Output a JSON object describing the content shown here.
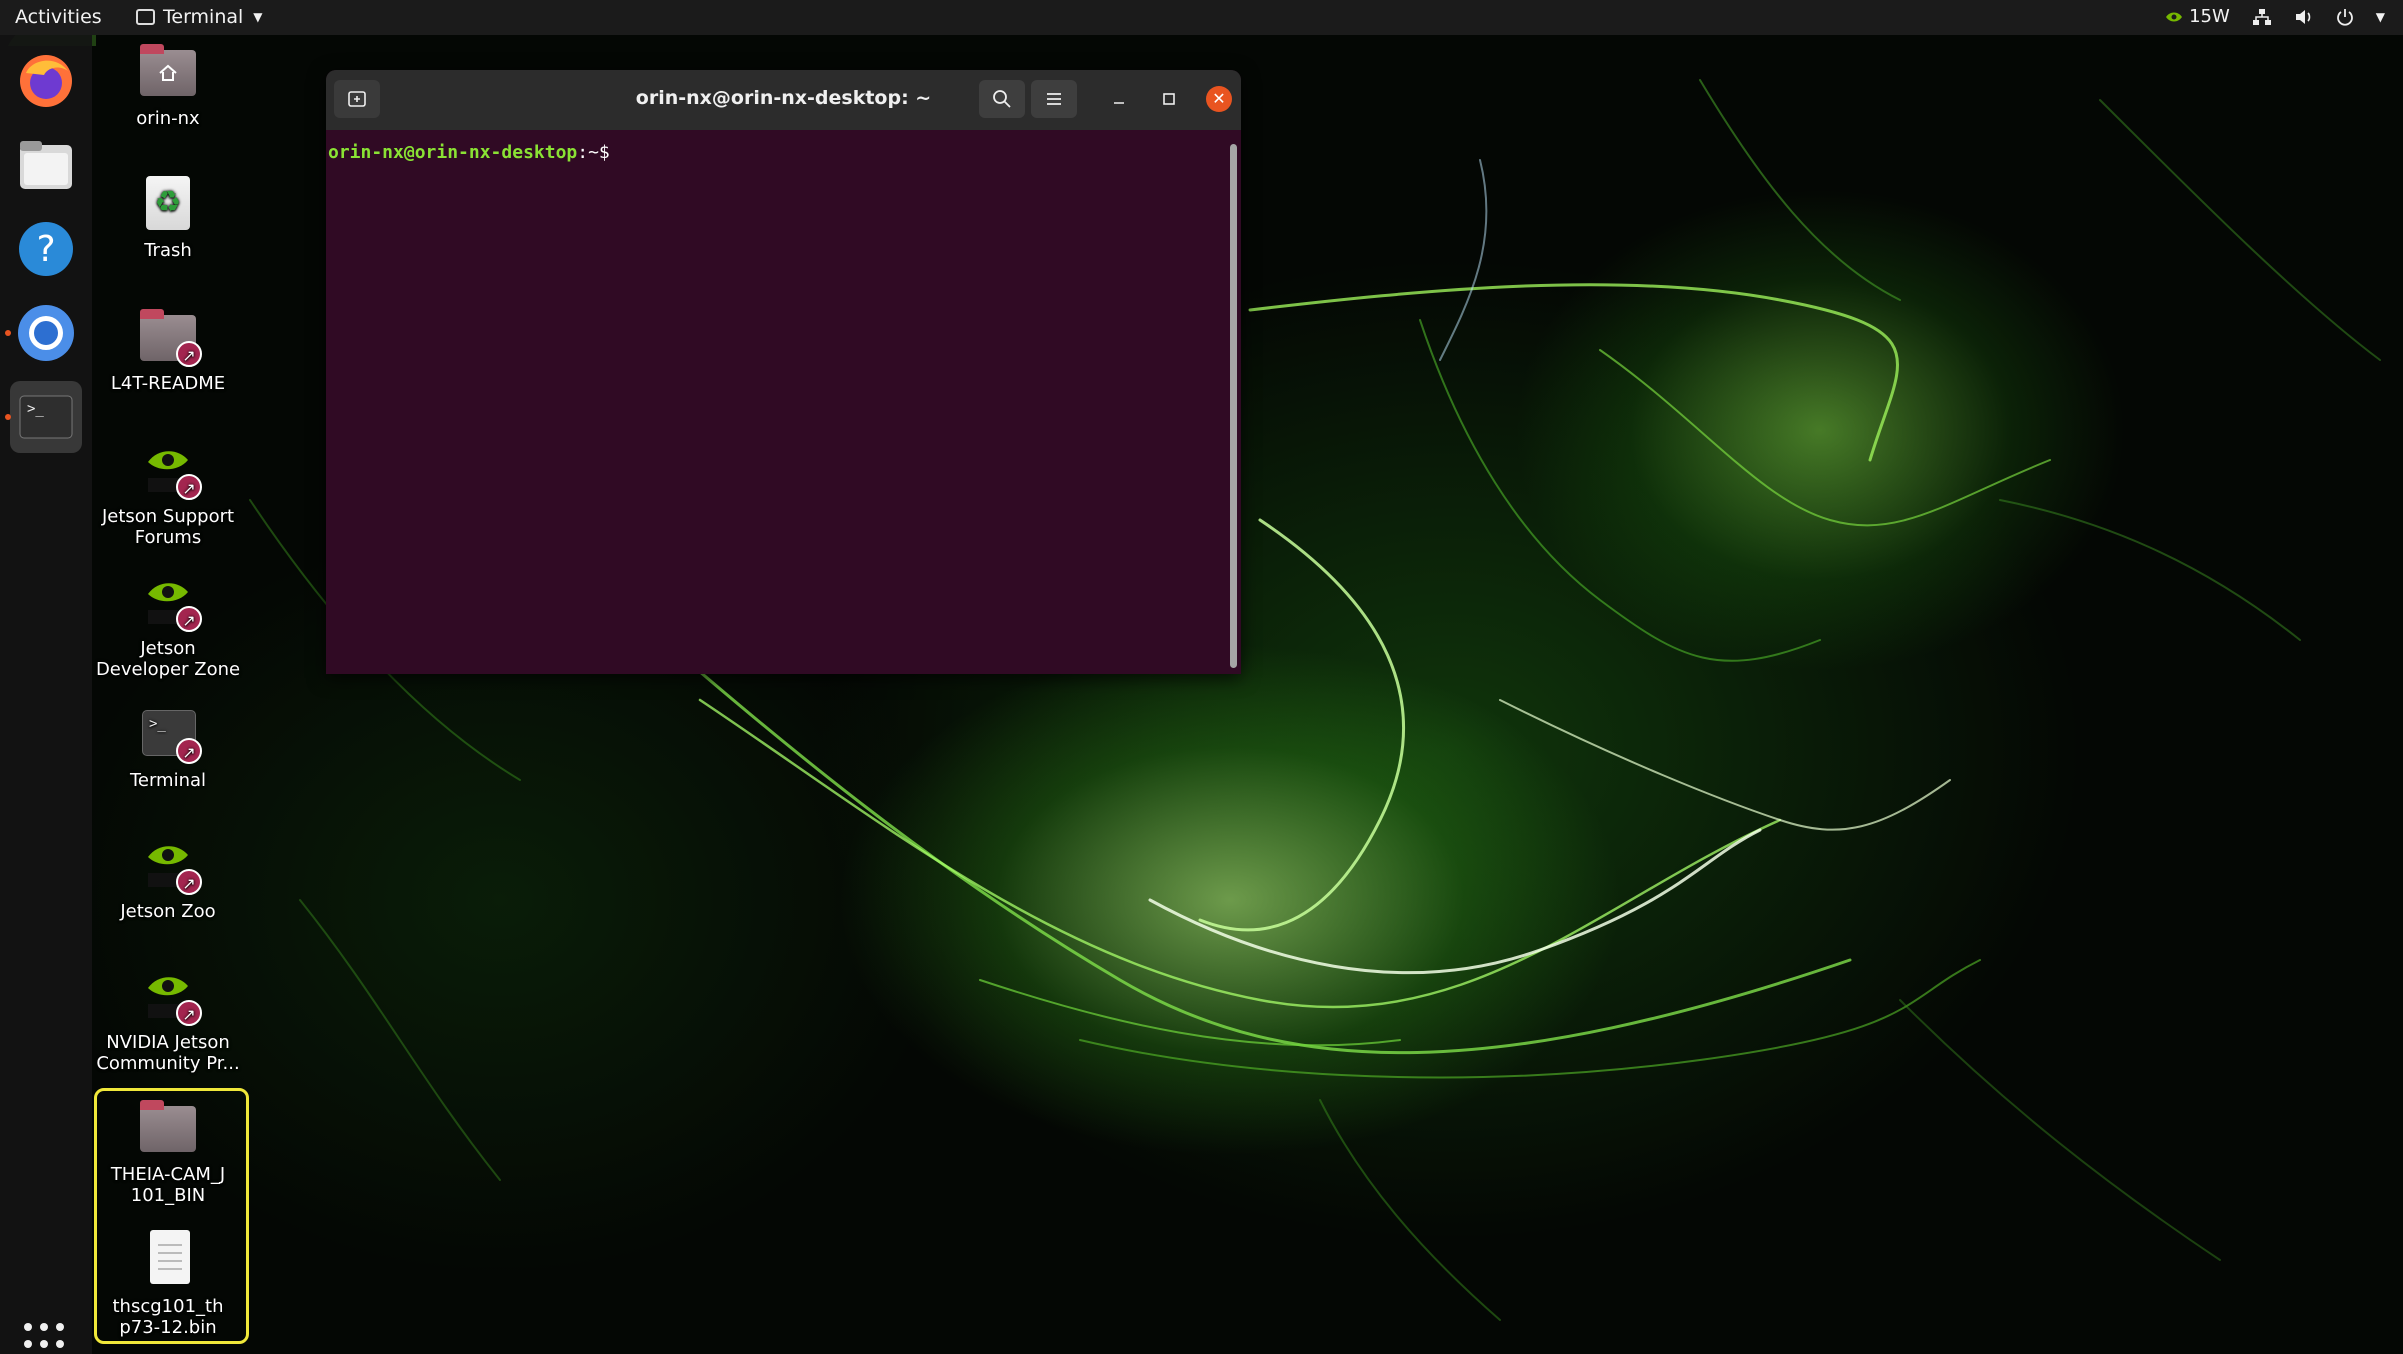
{
  "topbar": {
    "activities": "Activities",
    "app_name": "Terminal",
    "power_mode": "15W"
  },
  "dock": {
    "items": [
      "Firefox",
      "Files",
      "Help",
      "Chromium",
      "Terminal"
    ]
  },
  "desktop": {
    "icons": [
      {
        "label": "orin-nx"
      },
      {
        "label": "Trash"
      },
      {
        "label": "L4T-README"
      },
      {
        "label": "Jetson Support Forums"
      },
      {
        "label": "Jetson Developer Zone"
      },
      {
        "label": "Terminal"
      },
      {
        "label": "Jetson Zoo"
      },
      {
        "label": "NVIDIA Jetson Community Pr..."
      },
      {
        "label": "THEIA-CAM_J101_BIN"
      },
      {
        "label": "thscg101_thp73-12.bin"
      }
    ]
  },
  "terminal": {
    "title": "orin-nx@orin-nx-desktop: ~",
    "prompt_user": "orin-nx@orin-nx-desktop",
    "prompt_path": ":~$"
  },
  "colors": {
    "prompt_green": "#8ae234",
    "terminal_bg": "#300a24",
    "close_orange": "#e95420",
    "selection_yellow": "#f0e83a"
  }
}
